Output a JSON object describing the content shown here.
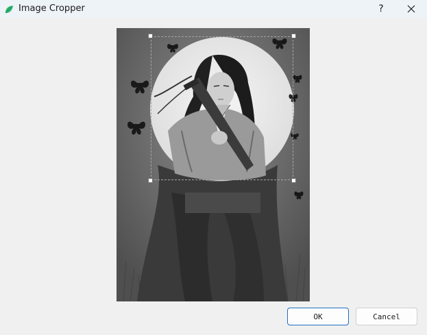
{
  "window": {
    "title": "Image Cropper",
    "help_label": "?"
  },
  "icons": {
    "app": "leaf-icon",
    "help": "question-mark-icon",
    "close": "close-icon"
  },
  "image": {
    "description_kind": "grayscale illustration",
    "crop_shape": "circle"
  },
  "buttons": {
    "ok_label": "OK",
    "cancel_label": "Cancel"
  },
  "colors": {
    "accent": "#1f6fbf",
    "titlebar": "#eef3f8",
    "background": "#f0f0f0"
  }
}
